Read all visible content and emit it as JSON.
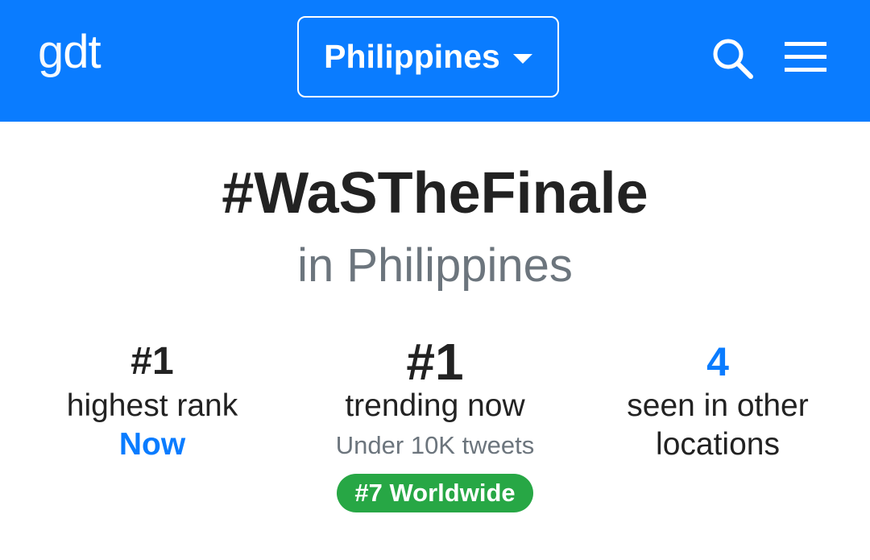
{
  "header": {
    "logo_g": "g",
    "logo_dt": "dt",
    "country_selector": "Philippines",
    "icons": [
      "search-icon",
      "menu-icon",
      "caret-down-icon"
    ]
  },
  "trend": {
    "title": "#WaSTheFinale",
    "location_text": "in Philippines"
  },
  "stats": {
    "highest": {
      "value": "#1",
      "label": "highest rank",
      "time": "Now"
    },
    "current": {
      "value": "#1",
      "label": "trending now",
      "volume": "Under 10K tweets",
      "worldwide": "#7 Worldwide"
    },
    "other": {
      "value": "4",
      "label_line1": "seen in other",
      "label_line2": "locations"
    }
  },
  "colors": {
    "brand_blue": "#0a7cff",
    "badge_green": "#27a745",
    "muted_grey": "#6c757d"
  }
}
